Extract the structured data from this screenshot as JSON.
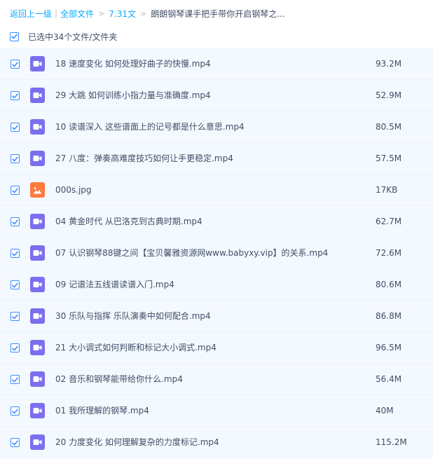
{
  "breadcrumb": {
    "back": "返回上一级",
    "all_files": "全部文件",
    "folder": "7.31文",
    "current": "朗朗钢琴课手把手带你开启钢琴之..."
  },
  "selection": {
    "label": "已选中34个文件/文件夹"
  },
  "files": [
    {
      "name": "18 速度变化 如何处理好曲子的快慢.mp4",
      "size": "93.2M",
      "type": "video"
    },
    {
      "name": "29 大跳 如何训练小指力量与准确度.mp4",
      "size": "52.9M",
      "type": "video"
    },
    {
      "name": "10 读谱深入 这些谱面上的记号都是什么意思.mp4",
      "size": "80.5M",
      "type": "video"
    },
    {
      "name": "27 八度：弹奏高难度技巧如何让手更稳定.mp4",
      "size": "57.5M",
      "type": "video"
    },
    {
      "name": "000s.jpg",
      "size": "17KB",
      "type": "image"
    },
    {
      "name": "04 黄金时代 从巴洛克到古典时期.mp4",
      "size": "62.7M",
      "type": "video"
    },
    {
      "name": "07 认识钢琴88键之间【宝贝馨雅资源网www.babyxy.vip】的关系.mp4",
      "size": "72.6M",
      "type": "video"
    },
    {
      "name": "09 记谱法五线谱读谱入门.mp4",
      "size": "80.6M",
      "type": "video"
    },
    {
      "name": "30 乐队与指挥 乐队演奏中如何配合.mp4",
      "size": "86.8M",
      "type": "video"
    },
    {
      "name": "21 大小调式如何判断和标记大小调式.mp4",
      "size": "96.5M",
      "type": "video"
    },
    {
      "name": "02 音乐和钢琴能带给你什么.mp4",
      "size": "56.4M",
      "type": "video"
    },
    {
      "name": "01 我所理解的钢琴.mp4",
      "size": "40M",
      "type": "video"
    },
    {
      "name": "20 力度变化 如何理解复杂的力度标记.mp4",
      "size": "115.2M",
      "type": "video"
    }
  ],
  "icons": {
    "checkbox": "check-icon",
    "video": "video-file-icon",
    "image": "image-file-icon"
  },
  "colors": {
    "link": "#09aaff",
    "checkbox": "#3b8cff",
    "video_icon": "#7b6ff0",
    "image_icon": "#ff7a3d",
    "row_selected": "#f3f9fe"
  }
}
